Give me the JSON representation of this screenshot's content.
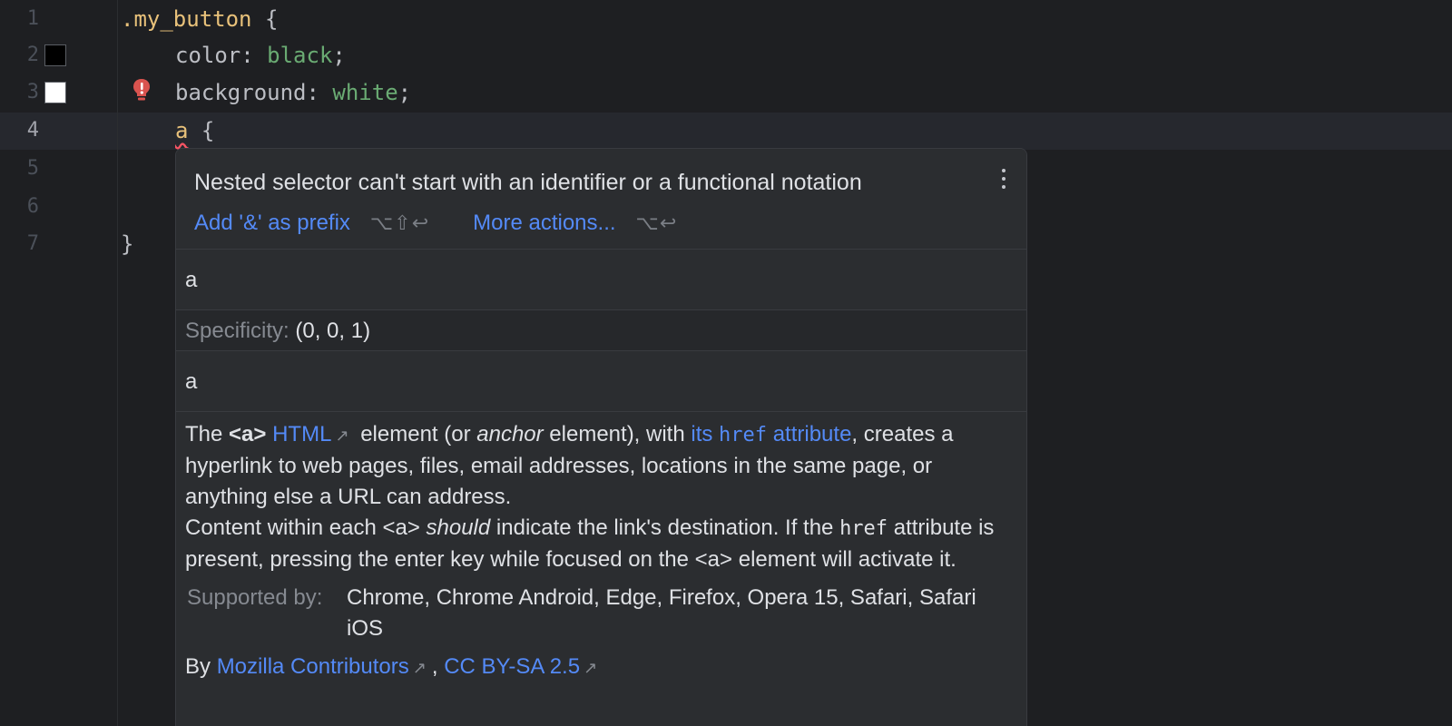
{
  "editor": {
    "line_numbers": [
      "1",
      "2",
      "3",
      "4",
      "5",
      "6",
      "7"
    ],
    "active_line": "4",
    "lines": {
      "l1_selector": ".my_button",
      "l1_brace": " {",
      "l2_prop": "color: ",
      "l2_val": "black",
      "l2_end": ";",
      "l3_prop": "background: ",
      "l3_val": "white",
      "l3_end": ";",
      "l4_tag": "a",
      "l4_brace": " {",
      "l7_brace": "}"
    },
    "swatches": {
      "line2": "#000000",
      "line3": "#ffffff"
    },
    "warning_icon": "error-bulb-icon"
  },
  "popup": {
    "title": "Nested selector can't start with an identifier or a functional notation",
    "actions": [
      {
        "label": "Add '&' as prefix",
        "shortcut": "⌥⇧↩"
      },
      {
        "label": "More actions...",
        "shortcut": "⌥↩"
      }
    ],
    "symbol_1": "a",
    "specificity_label": "Specificity:",
    "specificity_value": "(0, 0, 1)",
    "symbol_2": "a",
    "doc": {
      "p1_the": "The ",
      "p1_tag": "<a>",
      "p1_html_link": "HTML",
      "p1_mid": " element (or ",
      "p1_anchor": "anchor",
      "p1_mid2": " element), with ",
      "p1_href_pre": "its ",
      "p1_href_code": "href",
      "p1_href_post": " attribute",
      "p1_end": ", creates a hyperlink to web pages, files, email addresses, locations in the same page, or anything else a URL can address.",
      "p2_a": "Content within each <a> ",
      "p2_should": "should",
      "p2_b": " indicate the link's destination. If the ",
      "p2_code": "href",
      "p2_c": " attribute is present, pressing the enter key while focused on the <a> element will activate it.",
      "supported_label": "Supported by:",
      "supported_value": "Chrome, Chrome Android, Edge, Firefox, Opera 15, Safari, Safari iOS",
      "by": "By ",
      "author_link": "Mozilla Contributors",
      "comma": ", ",
      "license_link": "CC BY-SA 2.5",
      "external_icon": "↗"
    }
  }
}
